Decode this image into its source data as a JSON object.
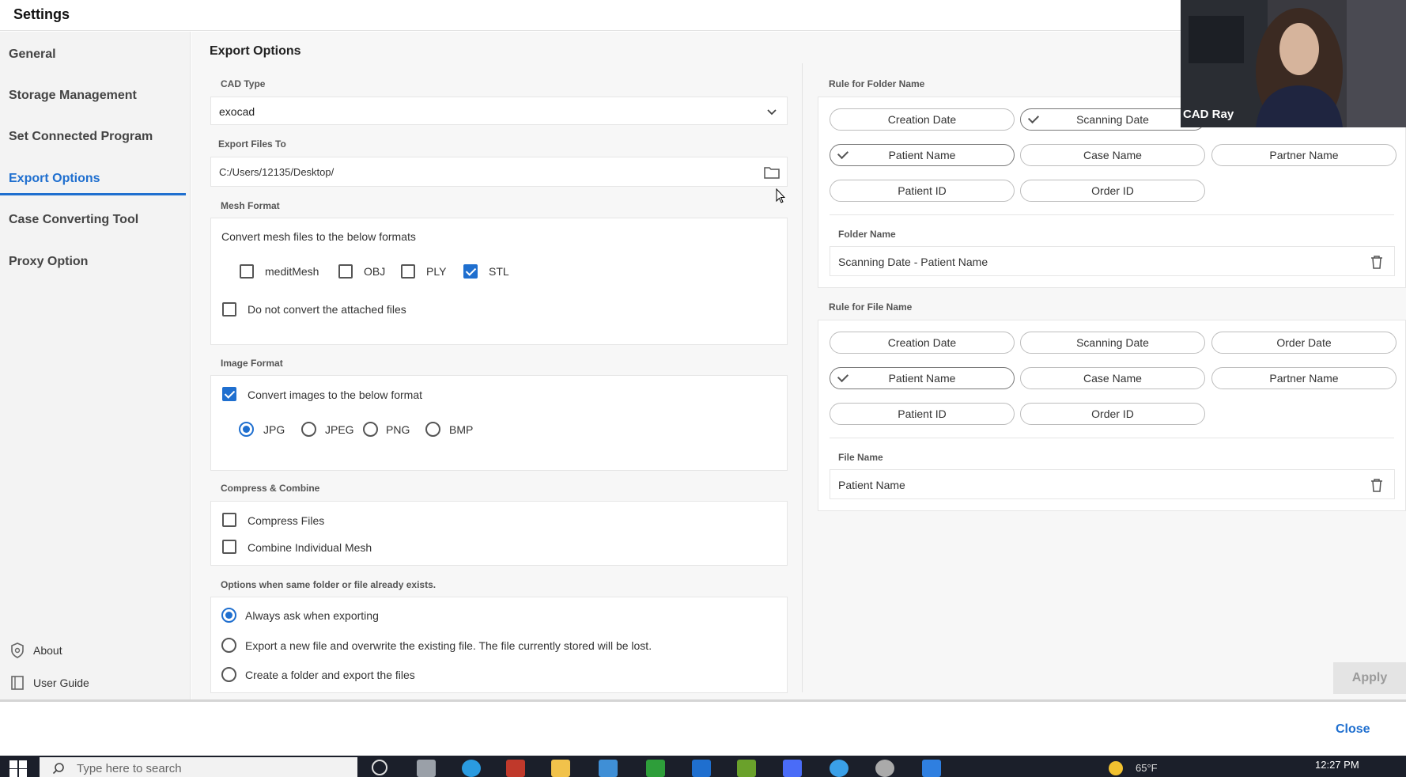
{
  "window": {
    "title": "Settings"
  },
  "sidebar": {
    "items": [
      {
        "label": "General"
      },
      {
        "label": "Storage Management"
      },
      {
        "label": "Set Connected Program"
      },
      {
        "label": "Export Options"
      },
      {
        "label": "Case Converting Tool"
      },
      {
        "label": "Proxy Option"
      }
    ],
    "active": "Export Options",
    "footer": {
      "about": "About",
      "user_guide": "User Guide"
    }
  },
  "export": {
    "title": "Export Options",
    "cad_type": {
      "label": "CAD Type",
      "value": "exocad"
    },
    "export_to": {
      "label": "Export Files To",
      "value": "C:/Users/12135/Desktop/"
    },
    "mesh": {
      "label": "Mesh Format",
      "description": "Convert mesh files to the below formats",
      "formats": [
        {
          "label": "meditMesh",
          "checked": false
        },
        {
          "label": "OBJ",
          "checked": false
        },
        {
          "label": "PLY",
          "checked": false
        },
        {
          "label": "STL",
          "checked": true
        }
      ],
      "no_convert": {
        "label": "Do not convert the attached files",
        "checked": false
      }
    },
    "image": {
      "label": "Image Format",
      "convert": {
        "label": "Convert images to the below format",
        "checked": true
      },
      "formats": [
        "JPG",
        "JPEG",
        "PNG",
        "BMP"
      ],
      "selected": "JPG"
    },
    "compress": {
      "label": "Compress & Combine",
      "compress_files": {
        "label": "Compress Files",
        "checked": false
      },
      "combine_mesh": {
        "label": "Combine Individual Mesh",
        "checked": false
      }
    },
    "exists": {
      "label": "Options when same folder or file already exists.",
      "options": [
        "Always ask when exporting",
        "Export a new file and overwrite the existing file. The file currently stored will be lost.",
        "Create a folder and export the files"
      ],
      "selected": 0
    }
  },
  "folder_rule": {
    "label": "Rule for Folder Name",
    "chips": [
      {
        "label": "Creation Date",
        "selected": false
      },
      {
        "label": "Scanning Date",
        "selected": true
      },
      {
        "label": "Patient Name",
        "selected": true
      },
      {
        "label": "Case Name",
        "selected": false
      },
      {
        "label": "Partner Name",
        "selected": false
      },
      {
        "label": "Patient ID",
        "selected": false
      },
      {
        "label": "Order ID",
        "selected": false
      }
    ],
    "name_label": "Folder Name",
    "name_value": "Scanning Date - Patient Name"
  },
  "file_rule": {
    "label": "Rule for File Name",
    "chips": [
      {
        "label": "Creation Date",
        "selected": false
      },
      {
        "label": "Scanning Date",
        "selected": false
      },
      {
        "label": "Order Date",
        "selected": false
      },
      {
        "label": "Patient Name",
        "selected": true
      },
      {
        "label": "Case Name",
        "selected": false
      },
      {
        "label": "Partner Name",
        "selected": false
      },
      {
        "label": "Patient ID",
        "selected": false
      },
      {
        "label": "Order ID",
        "selected": false
      }
    ],
    "name_label": "File Name",
    "name_value": "Patient Name"
  },
  "actions": {
    "apply": "Apply",
    "close": "Close"
  },
  "video_overlay": {
    "name": "CAD Ray"
  },
  "taskbar": {
    "search_placeholder": "Type here to search",
    "weather": "65°F",
    "clock": "12:27 PM"
  },
  "colors": {
    "accent": "#1f6fcf",
    "sidebar_bg": "#f3f3f3",
    "taskbar": "#1b1f2a"
  }
}
